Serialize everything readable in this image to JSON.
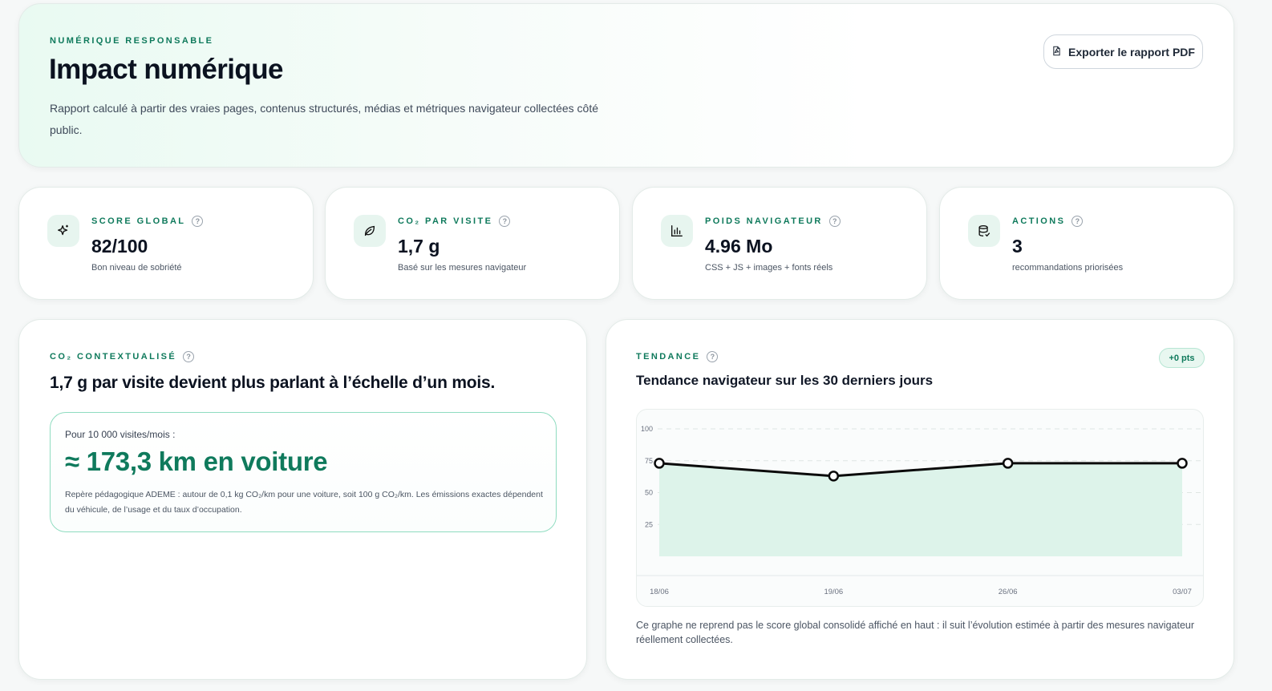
{
  "header": {
    "eyebrow": "NUMÉRIQUE RESPONSABLE",
    "title": "Impact numérique",
    "description": "Rapport calculé à partir des vraies pages, contenus structurés, médias et métriques navigateur collectées côté public.",
    "export_label": "Exporter le rapport PDF"
  },
  "kpis": [
    {
      "icon": "sparkles-icon",
      "label": "SCORE GLOBAL",
      "value": "82/100",
      "sub": "Bon niveau de sobriété"
    },
    {
      "icon": "leaf-icon",
      "label": "CO₂ PAR VISITE",
      "value": "1,7 g",
      "sub": "Basé sur les mesures navigateur"
    },
    {
      "icon": "bar-chart-icon",
      "label": "POIDS NAVIGATEUR",
      "value": "4.96 Mo",
      "sub": "CSS + JS + images + fonts réels"
    },
    {
      "icon": "database-icon",
      "label": "ACTIONS",
      "value": "3",
      "sub": "recommandations priorisées"
    }
  ],
  "co2": {
    "label": "CO₂ CONTEXTUALISÉ",
    "headline": "1,7 g par visite devient plus parlant à l’échelle d’un mois.",
    "pre": "Pour 10 000 visites/mois :",
    "big": "≈ 173,3 km en voiture",
    "note": "Repère pédagogique ADEME : autour de 0,1 kg CO₂/km pour une voiture, soit 100 g CO₂/km. Les émissions exactes dépendent du véhicule, de l’usage et du taux d’occupation."
  },
  "trend": {
    "label": "TENDANCE",
    "title": "Tendance navigateur sur les 30 derniers jours",
    "badge": "+0 pts",
    "footnote": "Ce graphe ne reprend pas le score global consolidé affiché en haut : il suit l’évolution estimée à partir des mesures navigateur réellement collectées."
  },
  "help_glyph": "?",
  "colors": {
    "accent": "#0f7a5c",
    "area_fill": "#ddf3ea",
    "line": "#0b0b0b"
  },
  "chart_data": {
    "type": "area",
    "categories": [
      "18/06",
      "19/06",
      "26/06",
      "03/07"
    ],
    "values": [
      73,
      63,
      73,
      73
    ],
    "ylim": [
      0,
      100
    ],
    "yticks": [
      25,
      50,
      75,
      100
    ],
    "grid": true
  }
}
